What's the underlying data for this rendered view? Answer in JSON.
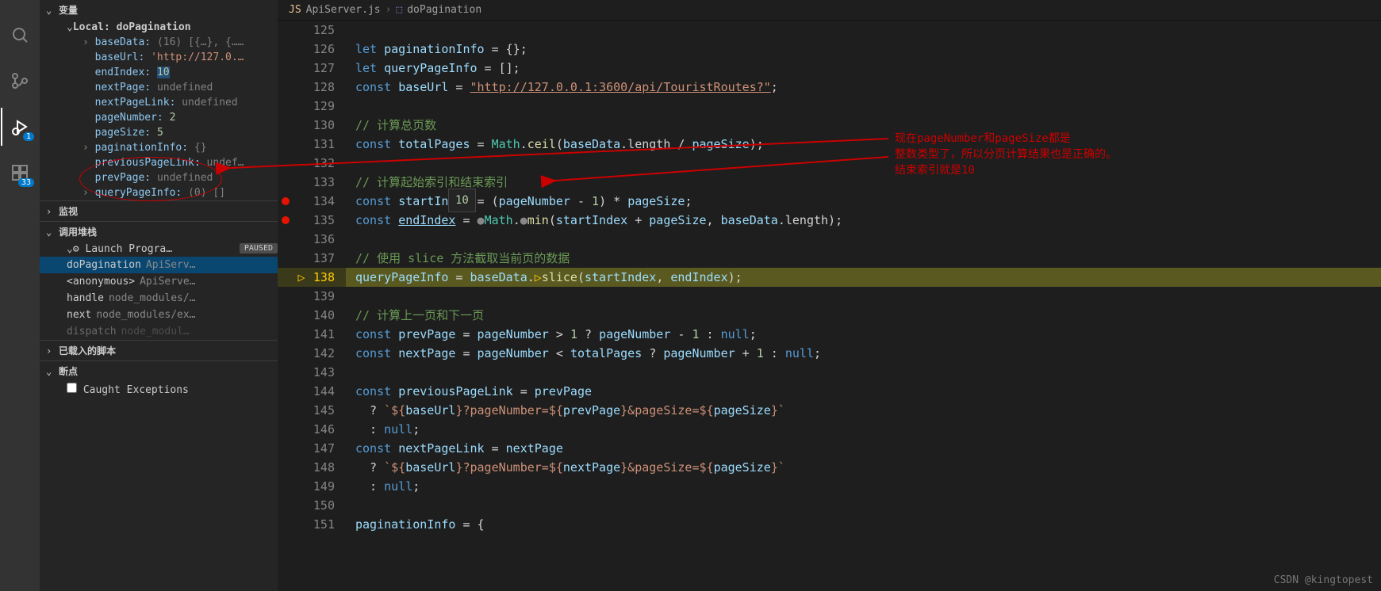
{
  "activity": {
    "badge_debug": "1",
    "badge_ext": "33"
  },
  "sidebar": {
    "variables_title": "变量",
    "scope": "Local: doPagination",
    "vars": {
      "baseData_name": "baseData:",
      "baseData_val": "(16) [{…}, {……",
      "baseUrl_name": "baseUrl:",
      "baseUrl_val": "'http://127.0.…",
      "endIndex_name": "endIndex:",
      "endIndex_val": "10",
      "nextPage_name": "nextPage:",
      "nextPage_val": "undefined",
      "nextPageLink_name": "nextPageLink:",
      "nextPageLink_val": "undefined",
      "pageNumber_name": "pageNumber:",
      "pageNumber_val": "2",
      "pageSize_name": "pageSize:",
      "pageSize_val": "5",
      "paginationInfo_name": "paginationInfo:",
      "paginationInfo_val": "{}",
      "previousPageLink_name": "previousPageLink:",
      "previousPageLink_val": "undef…",
      "prevPage_name": "prevPage:",
      "prevPage_val": "undefined",
      "queryPageInfo_name": "queryPageInfo:",
      "queryPageInfo_val": "(0) []"
    },
    "watch_title": "监视",
    "callstack_title": "调用堆栈",
    "launch": "Launch Progra…",
    "paused": "PAUSED",
    "stack": [
      {
        "fn": "doPagination",
        "file": "ApiServ…"
      },
      {
        "fn": "<anonymous>",
        "file": "ApiServe…"
      },
      {
        "fn": "handle",
        "file": "node_modules/…"
      },
      {
        "fn": "next",
        "file": "node_modules/ex…"
      },
      {
        "fn": "dispatch",
        "file": "node_modul…"
      }
    ],
    "loaded_title": "已载入的脚本",
    "breakpoints_title": "断点",
    "caught_exceptions": "Caught Exceptions"
  },
  "breadcrumb": {
    "icon": "JS",
    "file": "ApiServer.js",
    "symbol": "doPagination"
  },
  "hover_val": "10",
  "annot": {
    "l1": "现在pageNumber和pageSize都是",
    "l2": "整数类型了，所以分页计算结果也是正确的。",
    "l3": "结束索引就是10"
  },
  "watermark": "CSDN @kingtopest",
  "code": {
    "l125": "125",
    "l126": "126",
    "l127": "127",
    "l128": "128",
    "l129": "129",
    "l130": "130",
    "l131": "131",
    "l132": "132",
    "l133": "133",
    "l134": "134",
    "l135": "135",
    "l136": "136",
    "l137": "137",
    "l138": "138",
    "l139": "139",
    "l140": "140",
    "l141": "141",
    "l142": "142",
    "l143": "143",
    "l144": "144",
    "l145": "145",
    "l146": "146",
    "l147": "147",
    "l148": "148",
    "l149": "149",
    "l150": "150",
    "l151": "151",
    "c126_let": "let",
    "c126_v": "paginationInfo",
    "c126_r": " = {};",
    "c127_let": "let",
    "c127_v": "queryPageInfo",
    "c127_r": " = [];",
    "c128_c": "const",
    "c128_v": "baseUrl",
    "c128_eq": " = ",
    "c128_s": "\"http://127.0.0.1:3600/api/TouristRoutes?\"",
    "c128_semi": ";",
    "c130": "// 计算总页数",
    "c131_c": "const",
    "c131_v": "totalPages",
    "c131_m": " = ",
    "c131_t": "Math",
    "c131_dot": ".",
    "c131_fn": "ceil",
    "c131_p": "(",
    "c131_b": "baseData",
    "c131_l": ".length / ",
    "c131_ps": "pageSize",
    "c131_e": ");",
    "c133": "// 计算起始索引和结束索引",
    "c134_c": "const",
    "c134_v": "startIndex",
    "c134_eq": " = (",
    "c134_pn": "pageNumber",
    "c134_m": " - ",
    "c134_1": "1",
    "c134_m2": ") * ",
    "c134_ps": "pageSize",
    "c134_e": ";",
    "c135_c": "const",
    "c135_v": "endIndex",
    "c135_eq": " = ",
    "c135_t": "Math",
    "c135_dot": ".",
    "c135_fn": "min",
    "c135_p": "(",
    "c135_si": "startIndex",
    "c135_pl": " + ",
    "c135_ps": "pageSize",
    "c135_cm": ", ",
    "c135_bd": "baseData",
    "c135_len": ".length);",
    "c137": "// 使用 slice 方法截取当前页的数据",
    "c138_v": "queryPageInfo",
    "c138_eq": " = ",
    "c138_bd": "baseData",
    "c138_dot": ".",
    "c138_fn": "slice",
    "c138_p": "(",
    "c138_si": "startIndex",
    "c138_cm": ", ",
    "c138_ei": "endIndex",
    "c138_e": ");",
    "c140": "// 计算上一页和下一页",
    "c141_c": "const",
    "c141_v": "prevPage",
    "c141_eq": " = ",
    "c141_pn": "pageNumber",
    "c141_gt": " > ",
    "c141_1": "1",
    "c141_q": " ? ",
    "c141_pn2": "pageNumber",
    "c141_m": " - ",
    "c141_12": "1",
    "c141_col": " : ",
    "c141_n": "null",
    "c141_e": ";",
    "c142_c": "const",
    "c142_v": "nextPage",
    "c142_eq": " = ",
    "c142_pn": "pageNumber",
    "c142_lt": " < ",
    "c142_tp": "totalPages",
    "c142_q": " ? ",
    "c142_pn2": "pageNumber",
    "c142_p": " + ",
    "c142_1": "1",
    "c142_col": " : ",
    "c142_n": "null",
    "c142_e": ";",
    "c144_c": "const",
    "c144_v": "previousPageLink",
    "c144_eq": " = ",
    "c144_pp": "prevPage",
    "c145_q": "  ? ",
    "c145_s": "`${",
    "c145_bu": "baseUrl",
    "c145_s2": "}?pageNumber=${",
    "c145_pp": "prevPage",
    "c145_s3": "}&pageSize=${",
    "c145_ps": "pageSize",
    "c145_s4": "}`",
    "c146": "  : ",
    "c146_n": "null",
    "c146_e": ";",
    "c147_c": "const",
    "c147_v": "nextPageLink",
    "c147_eq": " = ",
    "c147_np": "nextPage",
    "c148_q": "  ? ",
    "c148_s": "`${",
    "c148_bu": "baseUrl",
    "c148_s2": "}?pageNumber=${",
    "c148_np": "nextPage",
    "c148_s3": "}&pageSize=${",
    "c148_ps": "pageSize",
    "c148_s4": "}`",
    "c149": "  : ",
    "c149_n": "null",
    "c149_e": ";",
    "c151_v": "paginationInfo",
    "c151_r": " = {"
  }
}
